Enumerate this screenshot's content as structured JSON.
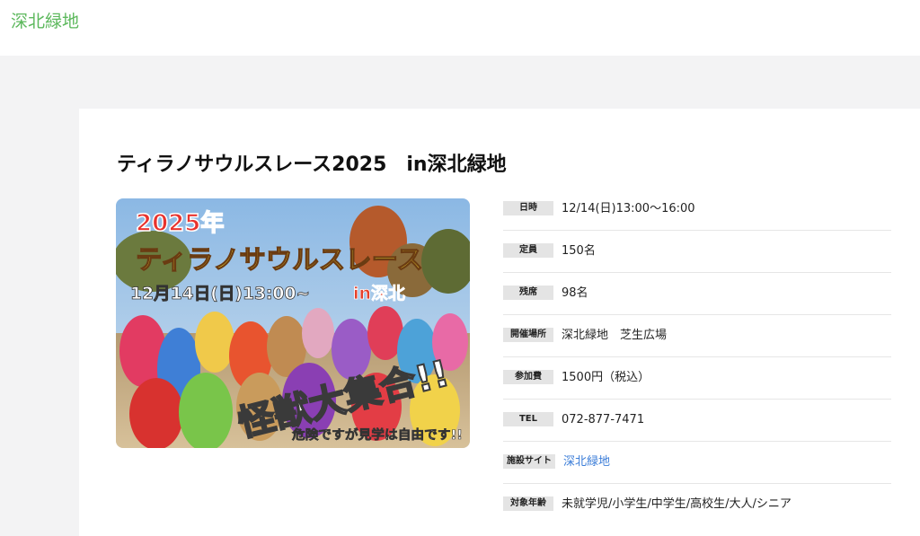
{
  "header": {
    "site_title": "深北緑地"
  },
  "event": {
    "title": "ティラノサウルスレース2025　in深北緑地"
  },
  "banner": {
    "year_text": "2025年",
    "race_text": "ティラノサウルスレース",
    "date_text": "12月14日(日)13:00~",
    "place_text": "in深北",
    "main_text": "怪獣大集合!!",
    "note_text": "危険ですが見学は自由です!!",
    "colors": {
      "sky": "#9fc3e6",
      "ground": "#c9b28a",
      "year": "#e8322d",
      "race": "#f7e33a",
      "accent": "#e6402a"
    }
  },
  "details": [
    {
      "label": "日時",
      "value": "12/14(日)13:00〜16:00",
      "link": false
    },
    {
      "label": "定員",
      "value": "150名",
      "link": false
    },
    {
      "label": "残席",
      "value": "98名",
      "link": false
    },
    {
      "label": "開催場所",
      "value": "深北緑地　芝生広場",
      "link": false
    },
    {
      "label": "参加費",
      "value": "1500円（税込）",
      "link": false
    },
    {
      "label": "TEL",
      "value": "072-877-7471",
      "link": false
    },
    {
      "label": "施設サイト",
      "value": "深北緑地",
      "link": true
    },
    {
      "label": "対象年齢",
      "value": "未就学児/小学生/中学生/高校生/大人/シニア",
      "link": false
    }
  ],
  "colors": {
    "site_title": "#5cb85c",
    "link": "#3b7dd8",
    "badge_bg": "#e4e4e4",
    "page_bg": "#f3f3f4"
  }
}
